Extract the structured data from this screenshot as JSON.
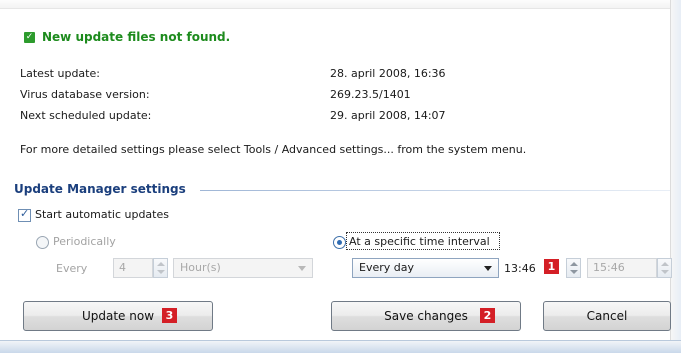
{
  "status": {
    "message": "New update files not found."
  },
  "info": {
    "rows": [
      {
        "label": "Latest update:",
        "value": "28. april 2008, 16:36"
      },
      {
        "label": "Virus database version:",
        "value": "269.23.5/1401"
      },
      {
        "label": "Next scheduled update:",
        "value": "29. april 2008, 14:07"
      }
    ],
    "note": "For more detailed settings please select Tools / Advanced settings... from the system menu."
  },
  "settings": {
    "title": "Update Manager settings",
    "auto_update": {
      "label": "Start automatic updates",
      "checked": true
    },
    "periodically": {
      "label": "Periodically",
      "selected": false,
      "enabled": false
    },
    "every_label": "Every",
    "every_value": "4",
    "unit_value": "Hour(s)",
    "specific": {
      "label": "At a specific time interval",
      "selected": true
    },
    "frequency_value": "Every day",
    "time_from": "13:46",
    "time_to": "15:46"
  },
  "badges": {
    "one": "1",
    "two": "2",
    "three": "3"
  },
  "buttons": {
    "update_now": "Update now",
    "save_changes": "Save changes",
    "cancel": "Cancel"
  },
  "colors": {
    "status_green": "#1d8b1d",
    "section_blue": "#1b3f7d",
    "badge_red": "#d41f26"
  }
}
